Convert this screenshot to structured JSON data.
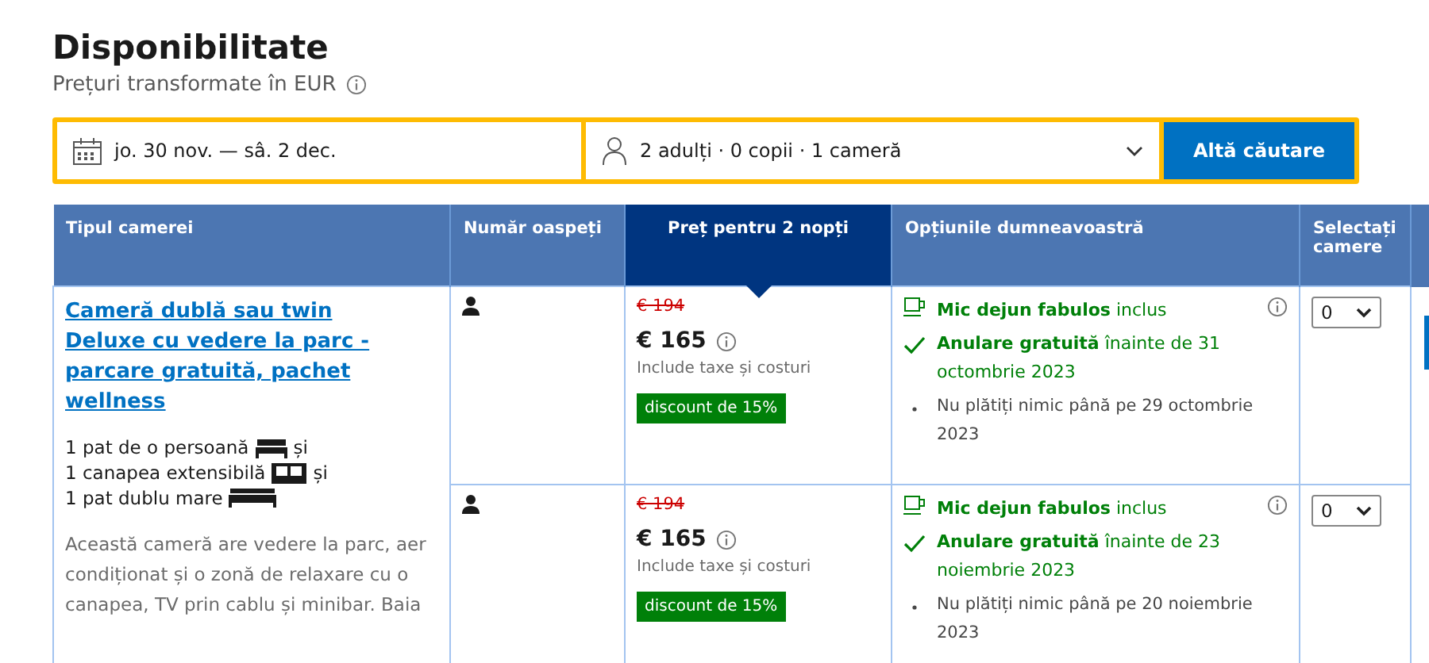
{
  "title": "Disponibilitate",
  "subtitle": "Prețuri transformate în EUR",
  "search": {
    "dates": "jo. 30 nov. — sâ. 2 dec.",
    "guests": "2 adulți · 0 copii · 1 cameră",
    "button": "Altă căutare"
  },
  "columns": [
    {
      "label": "Tipul camerei",
      "selected": false
    },
    {
      "label": "Număr oaspeți",
      "selected": false
    },
    {
      "label": "Preț pentru 2 nopți",
      "selected": true
    },
    {
      "label": "Opțiunile dumneavoastră",
      "selected": false
    },
    {
      "label": "Selectați camere",
      "selected": false
    }
  ],
  "room": {
    "name": "Cameră dublă sau twin Deluxe cu vedere la parc - parcare gratuită, pachet wellness",
    "beds": [
      {
        "text": "1 pat de o persoană",
        "kind": "single",
        "joiner": "și"
      },
      {
        "text": "1 canapea extensibilă",
        "kind": "sofa",
        "joiner": "și"
      },
      {
        "text": "1 pat dublu mare",
        "kind": "double"
      }
    ],
    "description": "Această cameră are vedere la parc, aer condiționat și o zonă de relaxare cu o canapea, TV prin cablu și minibar. Baia"
  },
  "offers": [
    {
      "old_price": "€ 194",
      "price": "€ 165",
      "taxes": "Include taxe și costuri",
      "discount": "discount de 15%",
      "meal": "**Mic dejun fabulos** inclus",
      "cancellation": "**Anulare gratuită** înainte de 31 octombrie 2023",
      "payment": "Nu plătiți nimic până pe 29 octombrie 2023",
      "rooms": "0"
    },
    {
      "old_price": "€ 194",
      "price": "€ 165",
      "taxes": "Include taxe și costuri",
      "discount": "discount de 15%",
      "meal": "**Mic dejun fabulos** inclus",
      "cancellation": "**Anulare gratuită** înainte de 23 noiembrie 2023",
      "payment": "Nu plătiți nimic până pe 20 noiembrie 2023",
      "rooms": "0"
    }
  ]
}
